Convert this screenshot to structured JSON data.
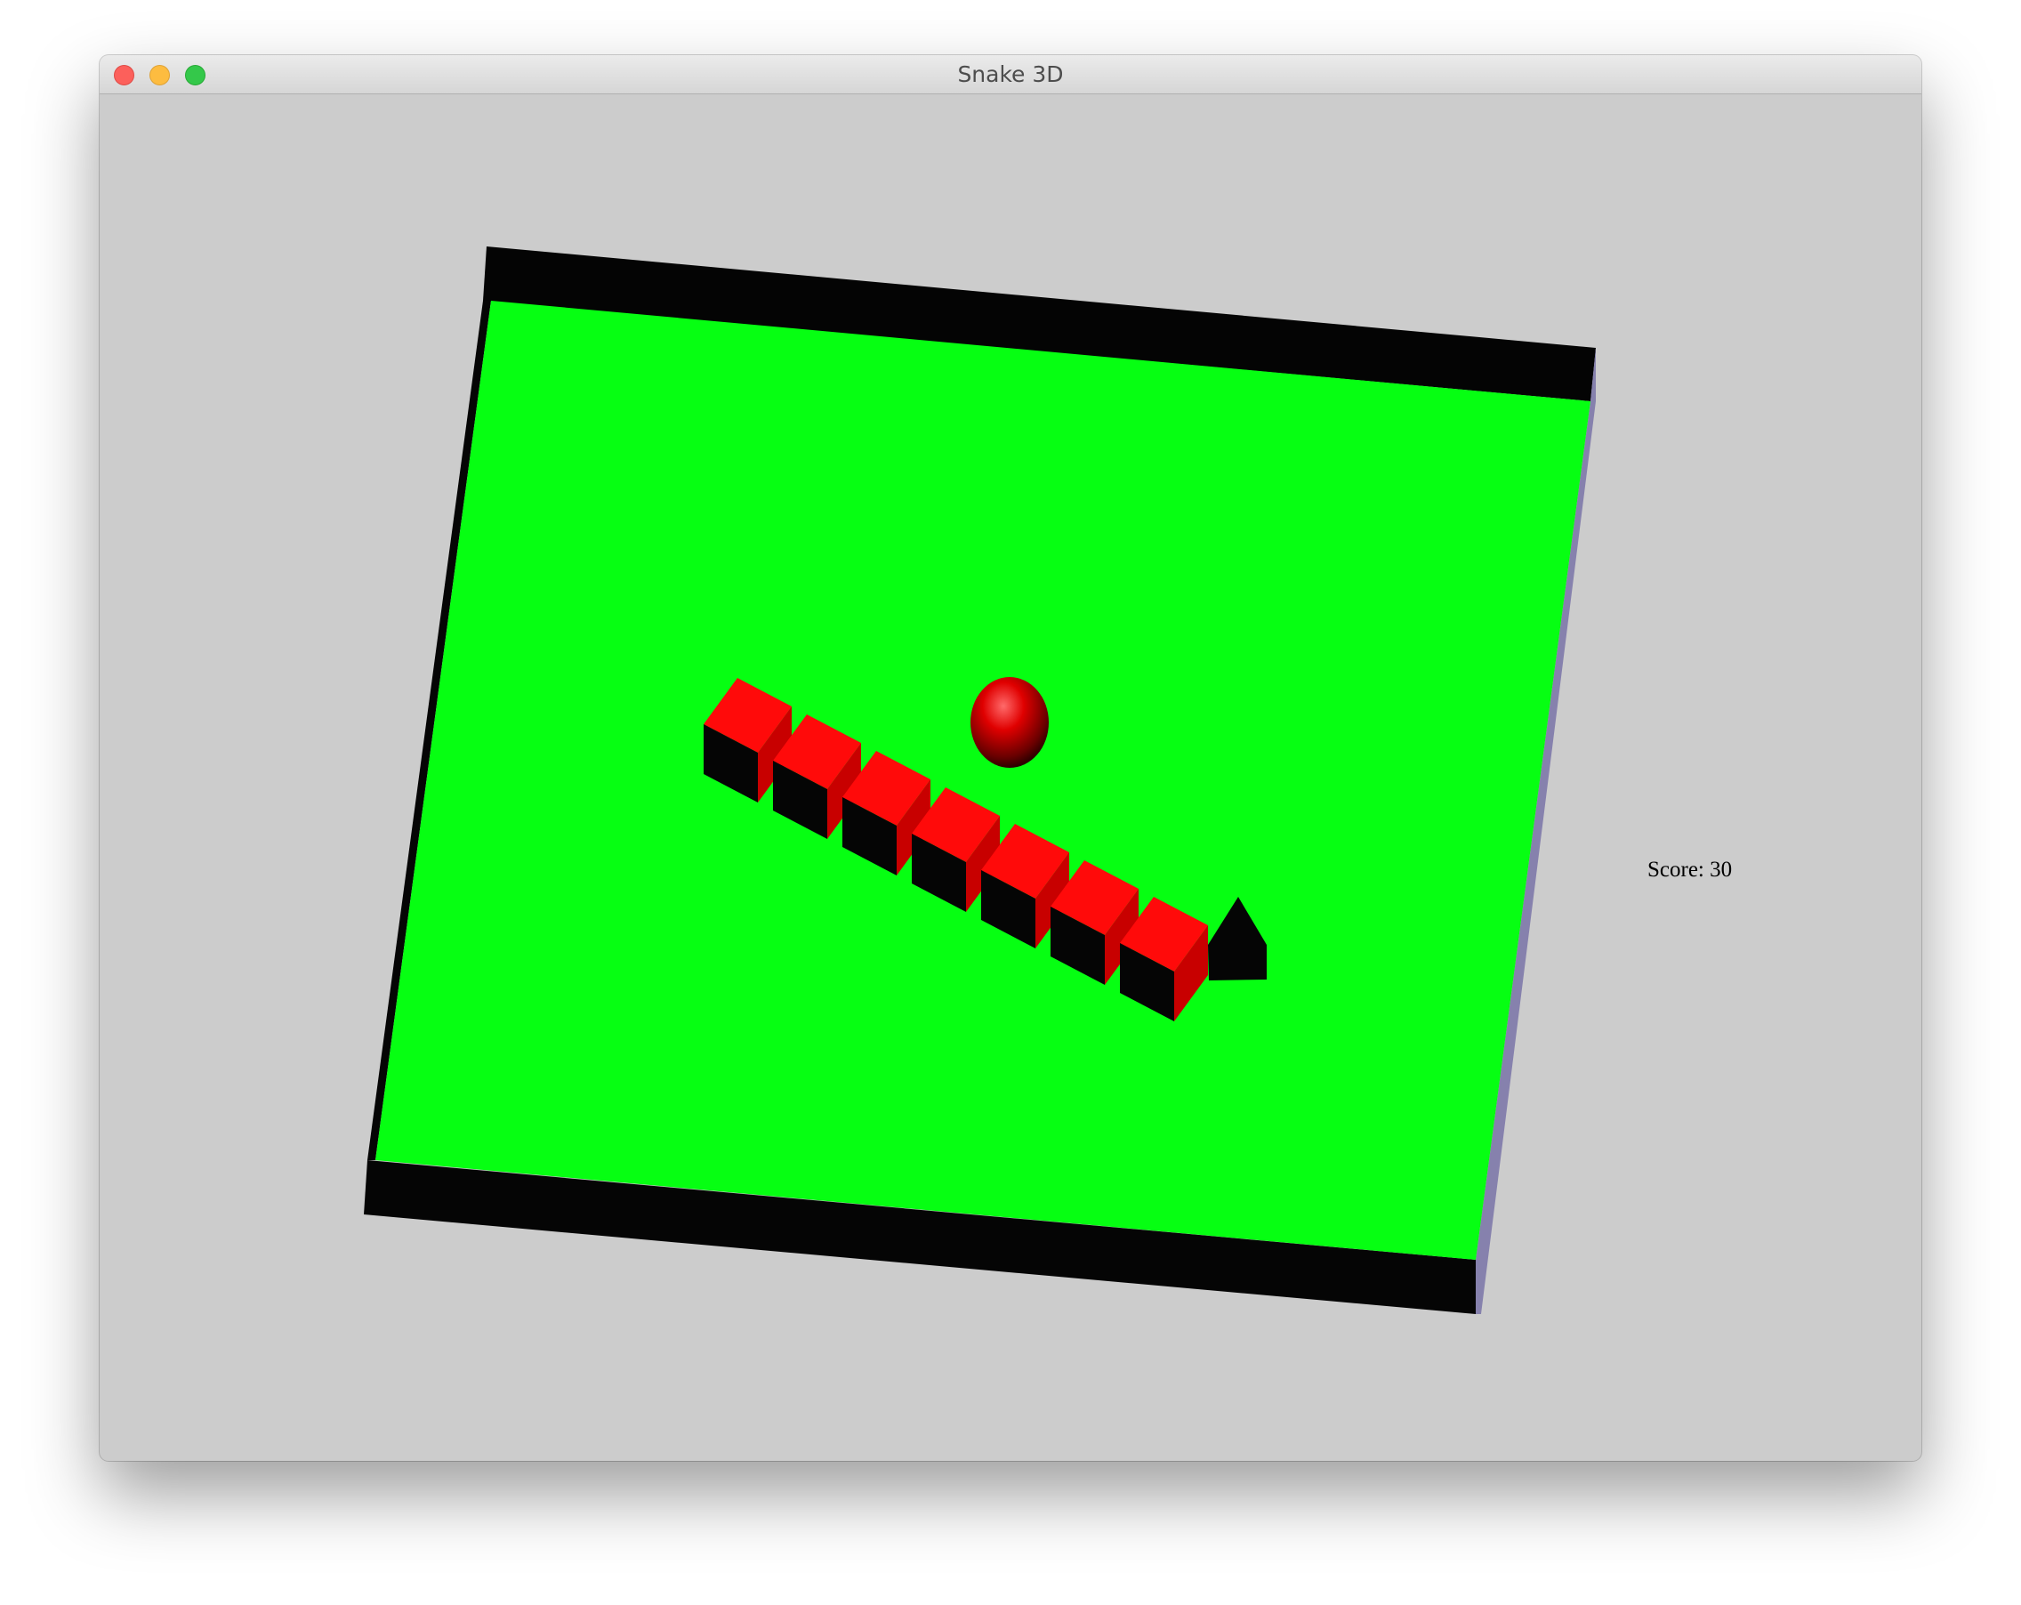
{
  "window": {
    "title": "Snake 3D",
    "buttons": [
      "close",
      "minimize",
      "zoom"
    ]
  },
  "game": {
    "score_text": "Score: 30",
    "board_color": "#06ff12",
    "board_edge_color": "#050505",
    "snake_color": "#ff0a0a",
    "food_color": "#e00000",
    "background_color": "#cccccc",
    "snake_segments": 7,
    "snake_head": "pentagon-prism",
    "food": "sphere"
  }
}
